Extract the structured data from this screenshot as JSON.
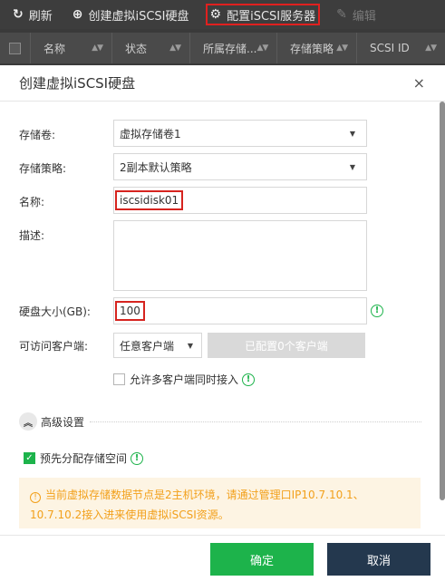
{
  "toolbar": {
    "refresh_icon": "refresh-icon",
    "refresh_label": "刷新",
    "create_icon": "plus-circle-icon",
    "create_label": "创建虚拟iSCSI硬盘",
    "config_icon": "gear-icon",
    "config_label": "配置iSCSI服务器",
    "edit_icon": "pencil-icon",
    "edit_label": "编辑"
  },
  "table": {
    "columns": [
      "名称",
      "状态",
      "所属存储...",
      "存储策略",
      "SCSI ID"
    ]
  },
  "dialog": {
    "title": "创建虚拟iSCSI硬盘",
    "close": "×",
    "fields": {
      "volume": {
        "label": "存储卷:",
        "value": "虚拟存储卷1"
      },
      "policy": {
        "label": "存储策略:",
        "value": "2副本默认策略"
      },
      "name": {
        "label": "名称:",
        "value": "iscsidisk01"
      },
      "description": {
        "label": "描述:",
        "value": ""
      },
      "size": {
        "label": "硬盘大小(GB):",
        "value": "100"
      },
      "clients": {
        "label": "可访问客户端:",
        "value": "任意客户端",
        "configured_label": "已配置0个客户端"
      }
    },
    "allow_multi_label": "允许多客户端同时接入",
    "allow_multi_checked": false,
    "advanced_label": "高级设置",
    "preallocate_label": "预先分配存储空间",
    "preallocate_checked": true,
    "notice": "当前虚拟存储数据节点是2主机环境，请通过管理口IP10.7.10.1、10.7.10.2接入进来使用虚拟iSCSI资源。",
    "ok_label": "确定",
    "cancel_label": "取消"
  },
  "colors": {
    "accent_green": "#1db34b",
    "highlight_red": "#d6241f",
    "cancel_navy": "#24384e",
    "notice_orange": "#f2a01b"
  }
}
